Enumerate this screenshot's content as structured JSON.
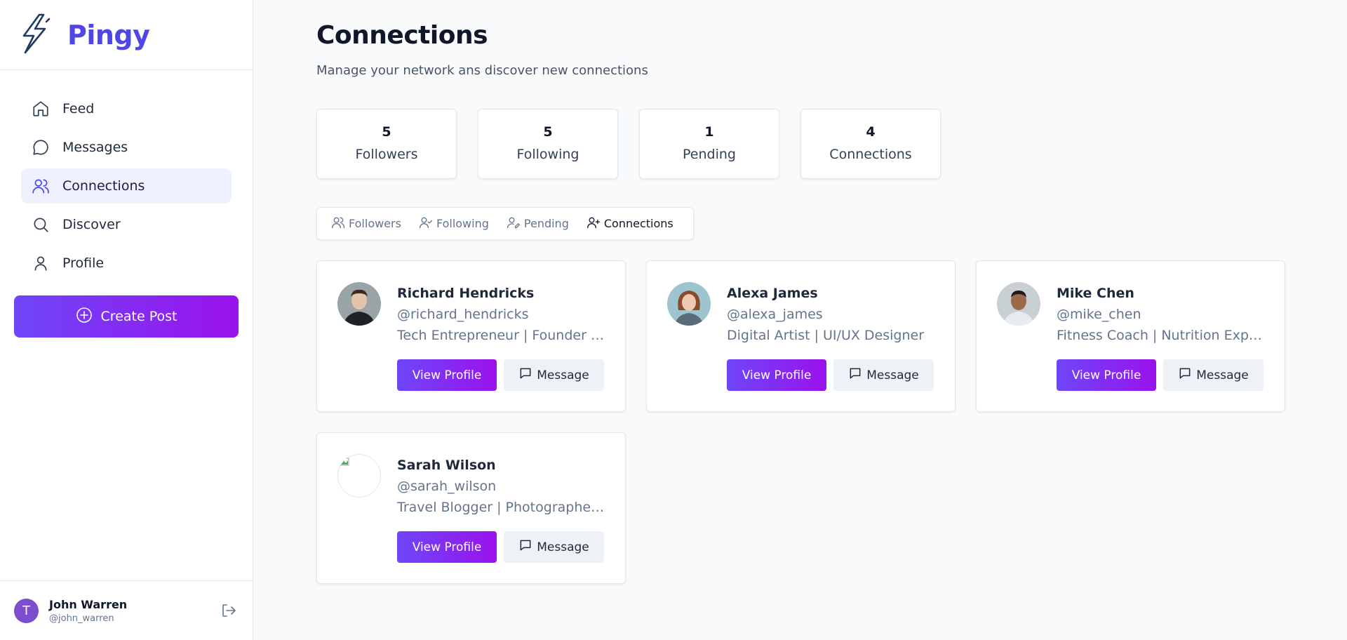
{
  "brand": {
    "name": "Pingy",
    "accent": "#4f46e5"
  },
  "sidebar": {
    "items": [
      {
        "label": "Feed",
        "icon": "home-icon"
      },
      {
        "label": "Messages",
        "icon": "chat-bubble-icon"
      },
      {
        "label": "Connections",
        "icon": "users-icon",
        "active": true
      },
      {
        "label": "Discover",
        "icon": "search-icon"
      },
      {
        "label": "Profile",
        "icon": "user-icon"
      }
    ],
    "create_post": "Create Post"
  },
  "user": {
    "initial": "T",
    "name": "John Warren",
    "handle": "@john_warren"
  },
  "page": {
    "title": "Connections",
    "subtitle": "Manage your network ans discover new connections"
  },
  "stats": [
    {
      "value": "5",
      "label": "Followers"
    },
    {
      "value": "5",
      "label": "Following"
    },
    {
      "value": "1",
      "label": "Pending"
    },
    {
      "value": "4",
      "label": "Connections"
    }
  ],
  "tabs": [
    {
      "label": "Followers",
      "icon": "users-icon"
    },
    {
      "label": "Following",
      "icon": "user-check-icon"
    },
    {
      "label": "Pending",
      "icon": "user-pen-icon"
    },
    {
      "label": "Connections",
      "icon": "user-plus-icon",
      "active": true
    }
  ],
  "connections": [
    {
      "name": "Richard Hendricks",
      "handle": "@richard_hendricks",
      "bio": "Tech Entrepreneur | Founder of Pied Piper"
    },
    {
      "name": "Alexa James",
      "handle": "@alexa_james",
      "bio": "Digital Artist | UI/UX Designer"
    },
    {
      "name": "Mike Chen",
      "handle": "@mike_chen",
      "bio": "Fitness Coach | Nutrition Expert"
    },
    {
      "name": "Sarah Wilson",
      "handle": "@sarah_wilson",
      "bio": "Travel Blogger | Photographer | Writer"
    }
  ],
  "card_actions": {
    "view": "View Profile",
    "message": "Message"
  }
}
